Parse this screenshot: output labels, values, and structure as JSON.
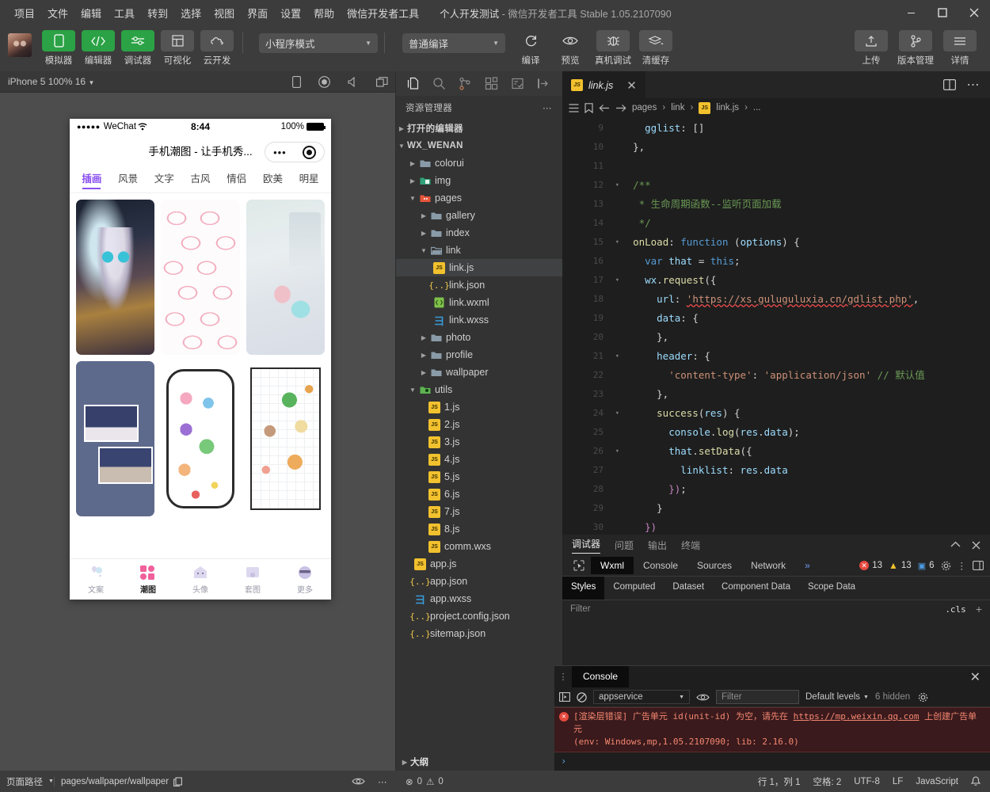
{
  "window": {
    "menus": [
      "项目",
      "文件",
      "编辑",
      "工具",
      "转到",
      "选择",
      "视图",
      "界面",
      "设置",
      "帮助",
      "微信开发者工具"
    ],
    "project_name": "个人开发测试",
    "title_suffix": "- 微信开发者工具 Stable 1.05.2107090",
    "controls": {
      "minimize": "minimize-icon",
      "maximize": "maximize-icon",
      "close": "close-icon"
    }
  },
  "toolbar": {
    "buttons": [
      {
        "label": "模拟器",
        "icon": "phone-icon",
        "active": true
      },
      {
        "label": "编辑器",
        "icon": "code-icon",
        "active": true
      },
      {
        "label": "调试器",
        "icon": "sliders-icon",
        "active": true
      },
      {
        "label": "可视化",
        "icon": "layout-icon",
        "active": false
      },
      {
        "label": "云开发",
        "icon": "cloud-icon",
        "active": false
      }
    ],
    "mode_select": "小程序模式",
    "compile_select": "普通编译",
    "actions": [
      {
        "label": "编译",
        "icon": "refresh-icon"
      },
      {
        "label": "预览",
        "icon": "eye-icon"
      },
      {
        "label": "真机调试",
        "icon": "bug-icon"
      },
      {
        "label": "清缓存",
        "icon": "layers-icon"
      }
    ],
    "right_actions": [
      {
        "label": "上传",
        "icon": "upload-icon"
      },
      {
        "label": "版本管理",
        "icon": "branch-icon"
      },
      {
        "label": "详情",
        "icon": "menu-icon"
      }
    ]
  },
  "simulator": {
    "device_label": "iPhone 5 100% 16",
    "top_icons": [
      "rotate-icon",
      "record-icon",
      "volume-icon",
      "windows-icon"
    ],
    "phone": {
      "status": {
        "dots": "●●●●●",
        "carrier": "WeChat",
        "wifi": "wifi-icon",
        "time": "8:44",
        "battery_pct": "100%"
      },
      "nav_title": "手机潮图 - 让手机秀...",
      "capsule": {
        "more": "•••",
        "target": "target-icon"
      },
      "tabs": [
        "插画",
        "风景",
        "文字",
        "古风",
        "情侣",
        "欧美",
        "明星"
      ],
      "active_tab": "插画",
      "thumbs": [
        "anime-girl-wallpaper",
        "pink-cinnamoroll-pattern",
        "soft-pastel-wallpaper",
        "navy-photo-collage",
        "doodle-stickers-sheet",
        "cute-animal-stickers-sheet"
      ],
      "tabbar": [
        {
          "label": "文案",
          "icon": "balloon-icon",
          "active": false
        },
        {
          "label": "潮图",
          "icon": "grid-icon",
          "active": true
        },
        {
          "label": "头像",
          "icon": "avatar-icon",
          "active": false
        },
        {
          "label": "套图",
          "icon": "album-icon",
          "active": false
        },
        {
          "label": "更多",
          "icon": "more-face-icon",
          "active": false
        }
      ]
    }
  },
  "explorer": {
    "activity_icons": [
      "files-icon",
      "search-icon",
      "source-control-icon",
      "extensions-icon",
      "test-icon",
      "login-icon"
    ],
    "title": "资源管理器",
    "more": "⋯",
    "sections": [
      {
        "label": "打开的编辑器",
        "expanded": false,
        "type": "section",
        "indent": 0
      },
      {
        "label": "WX_WENAN",
        "expanded": true,
        "type": "root",
        "indent": 0
      }
    ],
    "tree": [
      {
        "name": "colorui",
        "type": "folder",
        "indent": 1,
        "expanded": false
      },
      {
        "name": "img",
        "type": "folder-img",
        "indent": 1,
        "expanded": false
      },
      {
        "name": "pages",
        "type": "folder-pages",
        "indent": 1,
        "expanded": true
      },
      {
        "name": "gallery",
        "type": "folder",
        "indent": 2,
        "expanded": false
      },
      {
        "name": "index",
        "type": "folder",
        "indent": 2,
        "expanded": false
      },
      {
        "name": "link",
        "type": "folder-open",
        "indent": 2,
        "expanded": true
      },
      {
        "name": "link.js",
        "type": "js",
        "indent": 3,
        "selected": true
      },
      {
        "name": "link.json",
        "type": "json",
        "indent": 3
      },
      {
        "name": "link.wxml",
        "type": "wxml",
        "indent": 3
      },
      {
        "name": "link.wxss",
        "type": "wxss",
        "indent": 3
      },
      {
        "name": "photo",
        "type": "folder",
        "indent": 2,
        "expanded": false
      },
      {
        "name": "profile",
        "type": "folder",
        "indent": 2,
        "expanded": false
      },
      {
        "name": "wallpaper",
        "type": "folder",
        "indent": 2,
        "expanded": false
      },
      {
        "name": "utils",
        "type": "folder-utils",
        "indent": 1,
        "expanded": true
      },
      {
        "name": "1.js",
        "type": "js",
        "indent": 2
      },
      {
        "name": "2.js",
        "type": "js",
        "indent": 2
      },
      {
        "name": "3.js",
        "type": "js",
        "indent": 2
      },
      {
        "name": "4.js",
        "type": "js",
        "indent": 2
      },
      {
        "name": "5.js",
        "type": "js",
        "indent": 2
      },
      {
        "name": "6.js",
        "type": "js",
        "indent": 2
      },
      {
        "name": "7.js",
        "type": "js",
        "indent": 2
      },
      {
        "name": "8.js",
        "type": "js",
        "indent": 2
      },
      {
        "name": "comm.wxs",
        "type": "js",
        "indent": 2
      },
      {
        "name": "app.js",
        "type": "js",
        "indent": 1
      },
      {
        "name": "app.json",
        "type": "json",
        "indent": 1
      },
      {
        "name": "app.wxss",
        "type": "wxss",
        "indent": 1
      },
      {
        "name": "project.config.json",
        "type": "json",
        "indent": 1
      },
      {
        "name": "sitemap.json",
        "type": "json",
        "indent": 1
      }
    ],
    "outline_label": "大纲"
  },
  "editor": {
    "tab": {
      "name": "link.js",
      "icon": "js-icon",
      "close": "✕"
    },
    "tab_actions": [
      "split-editor-icon",
      "more-actions-icon"
    ],
    "breadcrumbs": [
      "pages",
      "link",
      "link.js",
      "..."
    ],
    "nav_icons": [
      "outline-icon",
      "bookmark-icon",
      "back-icon",
      "forward-icon"
    ],
    "first_line_number": 9,
    "lines": [
      {
        "n": 9,
        "fold": "",
        "html": "    <span class='id'>gglist</span><span class='pn'>: [</span><span class='pn'>]</span>"
      },
      {
        "n": 10,
        "fold": "",
        "html": "  <span class='pn'>},</span>"
      },
      {
        "n": 11,
        "fold": "",
        "html": ""
      },
      {
        "n": 12,
        "fold": "v",
        "html": "  <span class='cm'>/**</span>"
      },
      {
        "n": 13,
        "fold": "",
        "html": "   <span class='cm'>* 生命周期函数--监听页面加载</span>"
      },
      {
        "n": 14,
        "fold": "",
        "html": "   <span class='cm'>*/</span>"
      },
      {
        "n": 15,
        "fold": "v",
        "html": "  <span class='fn'>onLoad</span><span class='pn'>: </span><span class='kw'>function</span> <span class='pn'>(</span><span class='id'>options</span><span class='pn'>) {</span>"
      },
      {
        "n": 16,
        "fold": "",
        "html": "    <span class='kw'>var</span> <span class='id'>that</span> <span class='pn'>=</span> <span class='kw'>this</span><span class='pn'>;</span>"
      },
      {
        "n": 17,
        "fold": "v",
        "html": "    <span class='id'>wx</span><span class='pn'>.</span><span class='fn'>request</span><span class='pn'>({</span>"
      },
      {
        "n": 18,
        "fold": "",
        "html": "      <span class='id'>url</span><span class='pn'>: </span><span class='err-url'>'https://xs.guluguluxia.cn/gdlist.php'</span><span class='pn'>,</span>"
      },
      {
        "n": 19,
        "fold": "",
        "html": "      <span class='id'>data</span><span class='pn'>: {</span>"
      },
      {
        "n": 20,
        "fold": "",
        "html": "      <span class='pn'>},</span>"
      },
      {
        "n": 21,
        "fold": "v",
        "html": "      <span class='id'>header</span><span class='pn'>: {</span>"
      },
      {
        "n": 22,
        "fold": "",
        "html": "        <span class='str'>'content-type'</span><span class='pn'>: </span><span class='str'>'application/json'</span> <span class='cm'>// 默认值</span>"
      },
      {
        "n": 23,
        "fold": "",
        "html": "      <span class='pn'>},</span>"
      },
      {
        "n": 24,
        "fold": "v",
        "html": "      <span class='fn'>success</span><span class='pn'>(</span><span class='id'>res</span><span class='pn'>) {</span>"
      },
      {
        "n": 25,
        "fold": "",
        "html": "        <span class='id'>console</span><span class='pn'>.</span><span class='fn'>log</span><span class='pn'>(</span><span class='id'>res</span><span class='pn'>.</span><span class='id'>data</span><span class='pn'>);</span>"
      },
      {
        "n": 26,
        "fold": "v",
        "html": "        <span class='id'>that</span><span class='pn'>.</span><span class='fn'>setData</span><span class='pn'>({</span>"
      },
      {
        "n": 27,
        "fold": "",
        "html": "          <span class='id'>linklist</span><span class='pn'>: </span><span class='id'>res</span><span class='pn'>.</span><span class='id'>data</span>"
      },
      {
        "n": 28,
        "fold": "",
        "html": "        <span class='or'>})</span><span class='pn'>;</span>"
      },
      {
        "n": 29,
        "fold": "",
        "html": "      <span class='pn'>}</span>"
      },
      {
        "n": 30,
        "fold": "",
        "html": "    <span class='or'>})</span>"
      }
    ]
  },
  "debugger": {
    "panel_tabs": [
      "调试器",
      "问题",
      "输出",
      "终端"
    ],
    "panel_active": "调试器",
    "panel_actions": [
      "collapse-icon",
      "close-icon"
    ],
    "devtools_tabs": [
      "Wxml",
      "Console",
      "Sources",
      "Network"
    ],
    "devtools_active": "Wxml",
    "devtools_overflow": "»",
    "inspect_icon": "inspect-icon",
    "counts": {
      "errors": "13",
      "warnings": "13",
      "infos": "6"
    },
    "devtools_right_icons": [
      "gear-icon",
      "kebab-icon",
      "dock-icon"
    ],
    "style_tabs": [
      "Styles",
      "Computed",
      "Dataset",
      "Component Data",
      "Scope Data"
    ],
    "style_active": "Styles",
    "filter_placeholder": "Filter",
    "cls_label": ".cls",
    "add_rule": "+"
  },
  "console": {
    "tab_label": "Console",
    "grip": "⋮",
    "close": "✕",
    "toolbar_icons": [
      "sidebar-icon",
      "clear-icon",
      "eye-icon",
      "settings-icon"
    ],
    "context": "appservice",
    "filter_placeholder": "Filter",
    "levels": "Default levels",
    "hidden": "6 hidden",
    "message": {
      "prefix": "[渲染层错误] 广告单元 id(unit-id) 为空，请先在 ",
      "link": "https://mp.weixin.qq.com",
      "suffix": " 上创建广告单元",
      "env": "(env: Windows,mp,1.05.2107090; lib: 2.16.0)"
    },
    "prompt": "›"
  },
  "statusbar": {
    "page_path_label": "页面路径",
    "page_path": "pages/wallpaper/wallpaper",
    "copy_icon": "copy-icon",
    "eye_icon": "eye-icon",
    "more_icon": "⋯",
    "errors": "0",
    "warnings": "0",
    "position": "行 1，列 1",
    "indent": "空格: 2",
    "encoding": "UTF-8",
    "eol": "LF",
    "language": "JavaScript",
    "bell": "bell-icon"
  },
  "colors": {
    "accent_green": "#2ba245",
    "error_red": "#e4483d",
    "warning_yellow": "#f2c12e",
    "tab_purple": "#8a4ff0",
    "editor_bg": "#1e1e1e",
    "chrome_bg": "#3c3c3c"
  }
}
